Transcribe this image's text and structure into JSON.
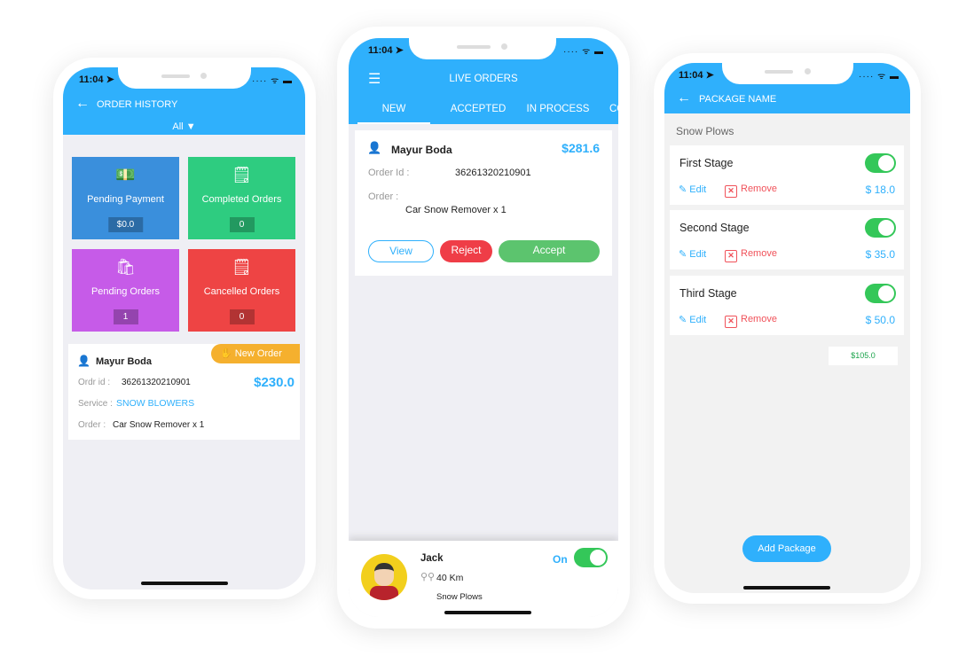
{
  "status_bar": {
    "time": "11:04 ➤",
    "icons": "···· ᯤ ▬"
  },
  "order_history": {
    "title": "ORDER HISTORY",
    "filter": "All",
    "tiles": [
      {
        "label": "Pending Payment",
        "value": "$0.0",
        "color": "#3a8fdc",
        "icon": "money-icon"
      },
      {
        "label": "Completed Orders",
        "value": "0",
        "color": "#2ecc80",
        "icon": "document-check-icon"
      },
      {
        "label": "Pending Orders",
        "value": "1",
        "color": "#c65be8",
        "icon": "hand-bag-icon"
      },
      {
        "label": "Cancelled Orders",
        "value": "0",
        "color": "#ee4444",
        "icon": "document-x-icon"
      }
    ],
    "order": {
      "badge": "New Order",
      "name": "Mayur Boda",
      "id_label": "Ordr id :",
      "id": "36261320210901",
      "amount": "$230.0",
      "service_label": "Service :",
      "service": "SNOW BLOWERS",
      "order_label": "Order  :",
      "order": "Car Snow Remover x 1"
    }
  },
  "live_orders": {
    "title": "LIVE ORDERS",
    "tabs": [
      {
        "label": "NEW",
        "active": true
      },
      {
        "label": "ACCEPTED"
      },
      {
        "label": "IN PROCESS"
      },
      {
        "label": "CO"
      }
    ],
    "order": {
      "name": "Mayur Boda",
      "amount": "$281.6",
      "id_label": "Order Id :",
      "id": "36261320210901",
      "order_label": "Order :",
      "order": "Car Snow Remover x 1",
      "view": "View",
      "reject": "Reject",
      "accept": "Accept"
    },
    "driver": {
      "name": "Jack",
      "distance": "40 Km",
      "service": "Snow Plows",
      "status": "On",
      "online": true
    }
  },
  "package": {
    "title": "PACKAGE NAME",
    "section": "Snow Plows",
    "stages": [
      {
        "name": "First Stage",
        "price": "$ 18.0",
        "enabled": true
      },
      {
        "name": "Second Stage",
        "price": "$ 35.0",
        "enabled": true
      },
      {
        "name": "Third Stage",
        "price": "$ 50.0",
        "enabled": true
      }
    ],
    "edit": "Edit",
    "remove": "Remove",
    "total": "$105.0",
    "add_button": "Add Package"
  }
}
